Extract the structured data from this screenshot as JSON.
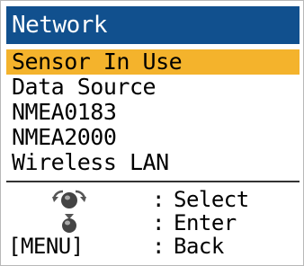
{
  "title": "Network",
  "menu": {
    "items": [
      {
        "label": "Sensor In Use",
        "selected": true
      },
      {
        "label": "Data Source",
        "selected": false
      },
      {
        "label": "NMEA0183",
        "selected": false
      },
      {
        "label": "NMEA2000",
        "selected": false
      },
      {
        "label": "Wireless LAN",
        "selected": false
      }
    ]
  },
  "legend": {
    "select": {
      "icon": "rotary-knob-icon",
      "separator": ":",
      "text": "Select"
    },
    "enter": {
      "icon": "knob-push-icon",
      "separator": ":",
      "text": "Enter"
    },
    "back": {
      "key": "[MENU]",
      "separator": ":",
      "text": "Back"
    }
  },
  "colors": {
    "title_bar": "#11508e",
    "highlight": "#f4b32c"
  }
}
